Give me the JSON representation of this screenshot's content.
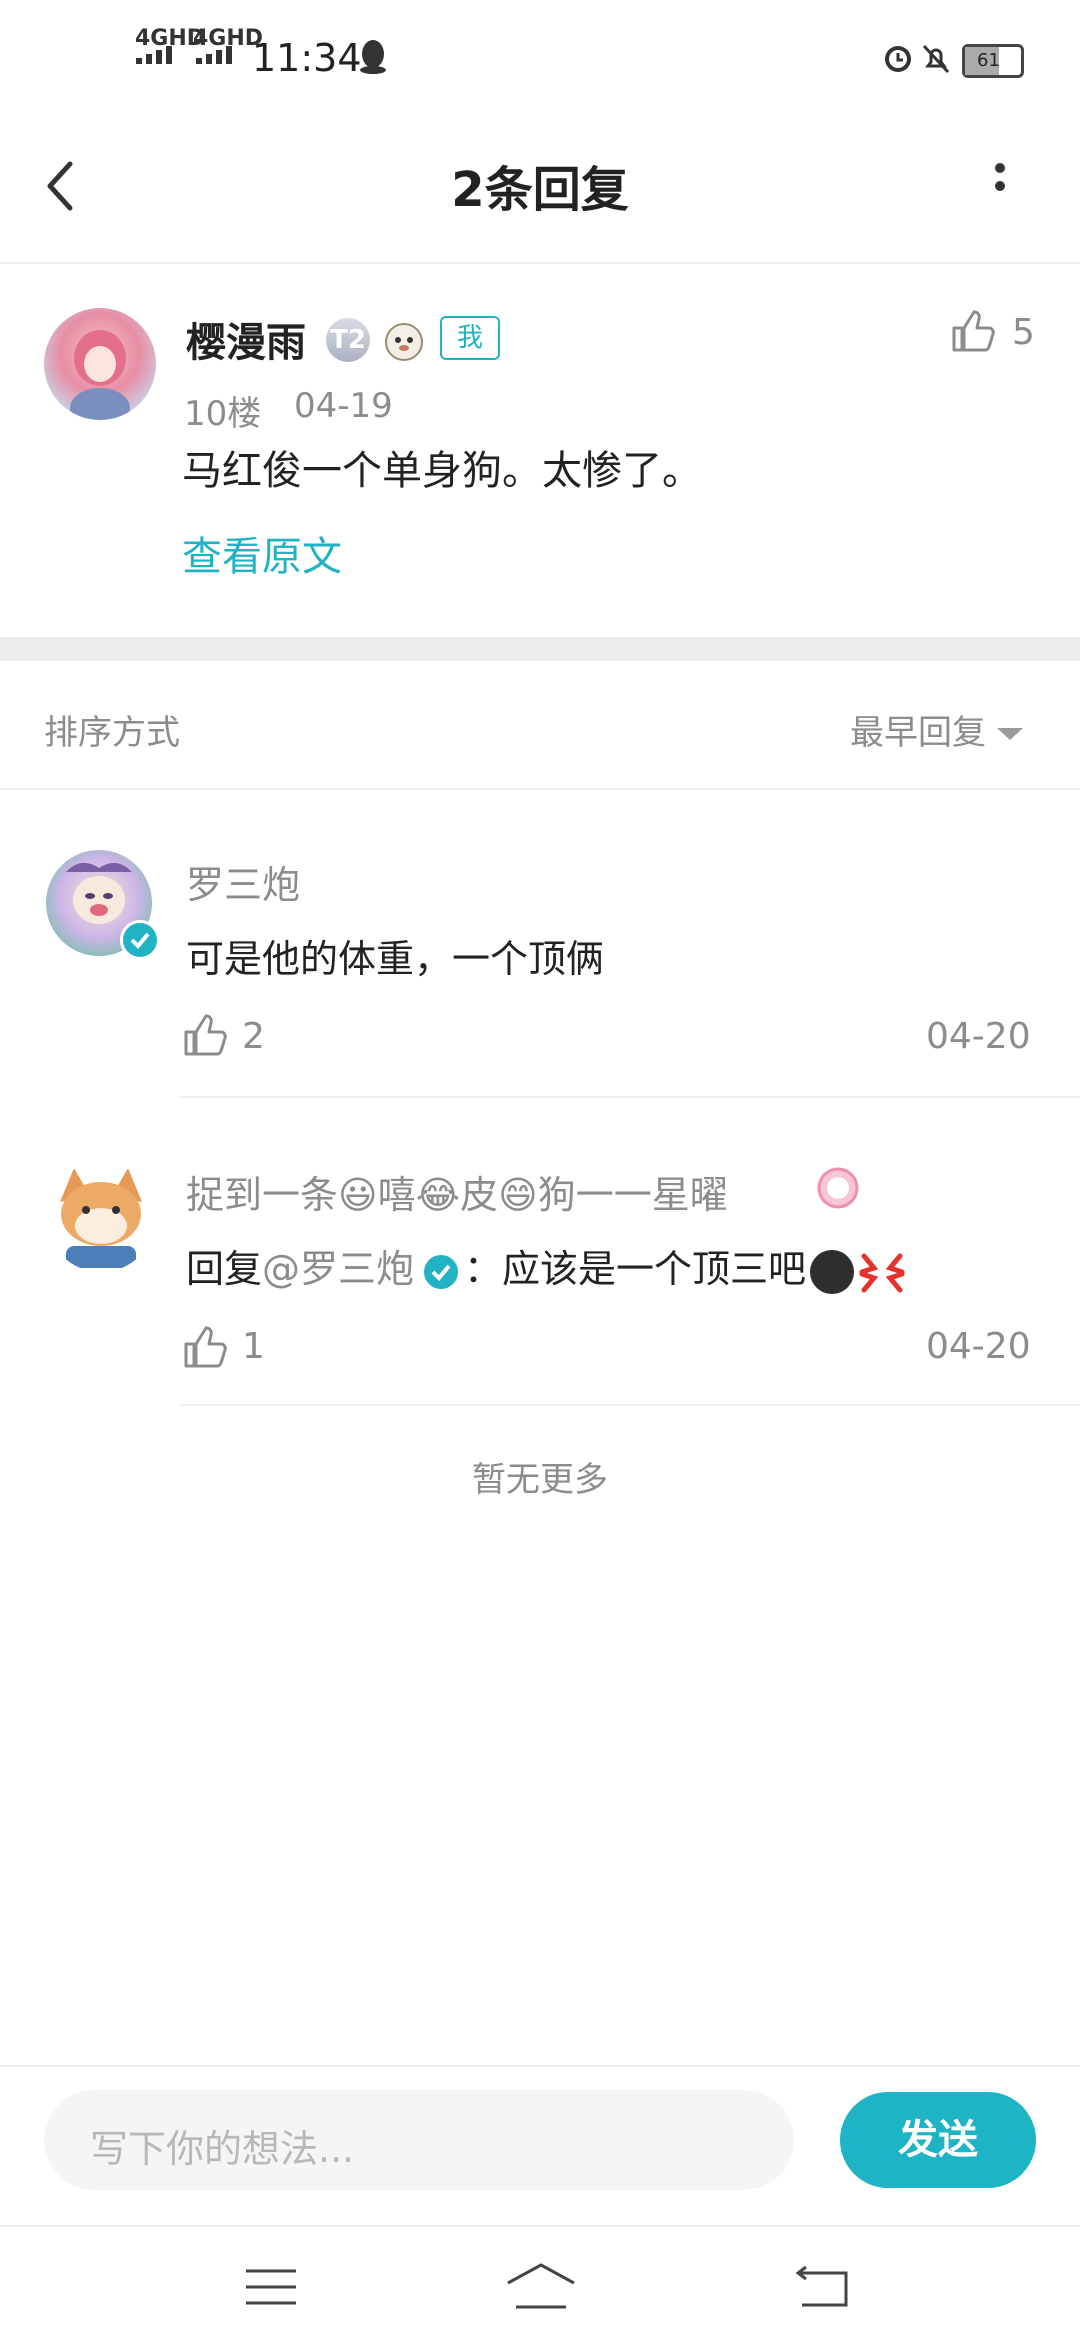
{
  "status_bar": {
    "network_1": "4GHD",
    "network_2": "4GHD",
    "time": "11:34",
    "battery": "61"
  },
  "header": {
    "title": "2条回复",
    "back_icon": "chevron-left-icon",
    "more_icon": "more-vertical-icon"
  },
  "original_post": {
    "username": "樱漫雨",
    "level_badge": "T2",
    "me_badge": "我",
    "floor": "10楼",
    "date": "04-19",
    "content": "马红俊一个单身狗。太惨了。",
    "view_original": "查看原文",
    "likes": "5"
  },
  "sort": {
    "label": "排序方式",
    "value": "最早回复"
  },
  "replies": [
    {
      "username": "罗三炮",
      "content": "可是他的体重，一个顶俩",
      "likes": "2",
      "date": "04-20"
    },
    {
      "username_parts": [
        "捉到一条",
        "😃",
        "嘻",
        "😂",
        "皮",
        "😄",
        "狗一一星曜"
      ],
      "content_prefix": "回复",
      "mention": "@罗三炮",
      "content_suffix": "：应该是一个顶三吧",
      "likes": "1",
      "date": "04-20"
    }
  ],
  "end_text": "暂无更多",
  "composer": {
    "placeholder": "写下你的想法...",
    "send_label": "发送"
  },
  "colors": {
    "accent": "#1fb3c4",
    "divider": "#ececec"
  }
}
